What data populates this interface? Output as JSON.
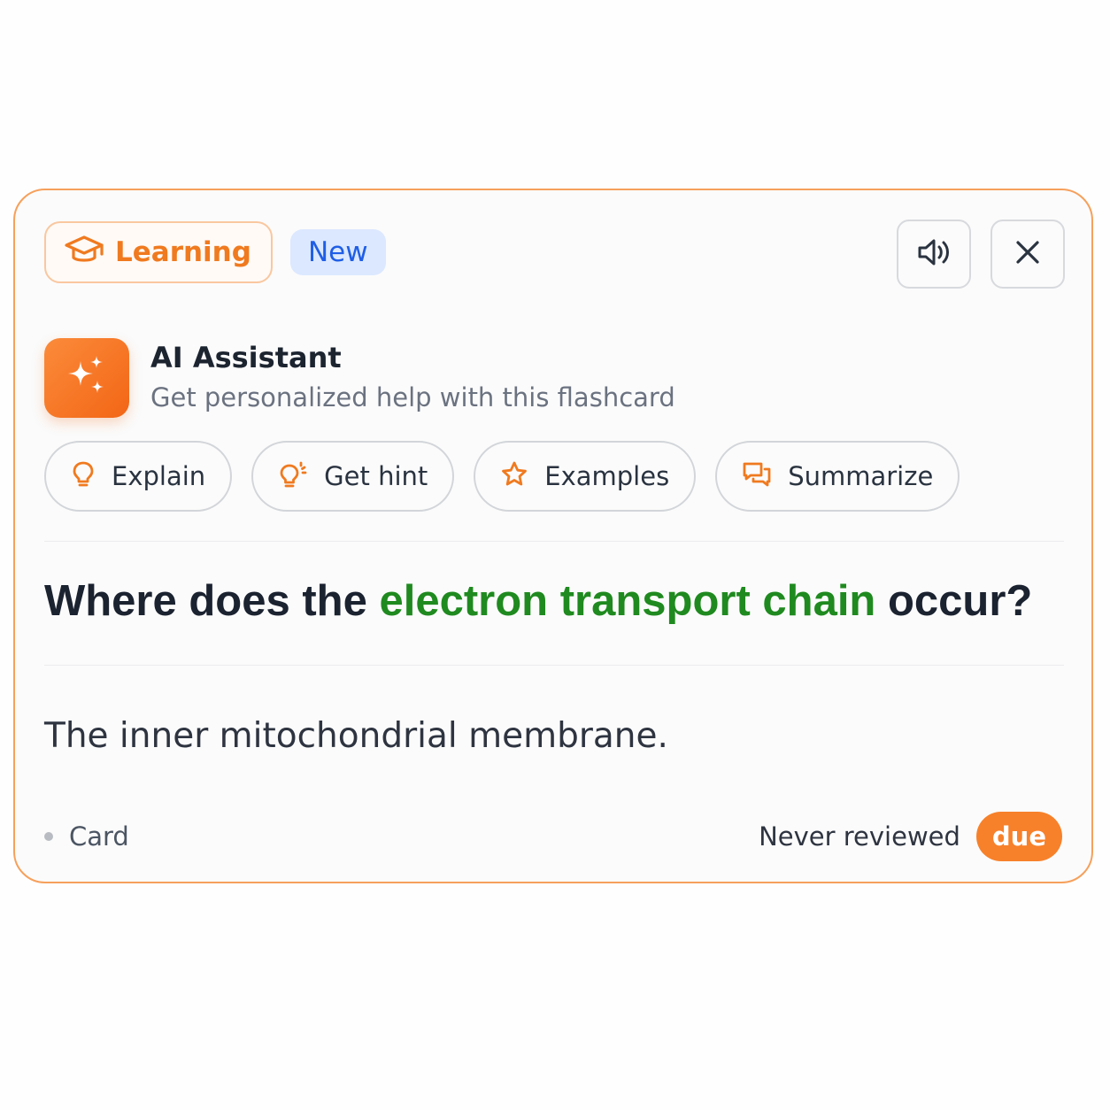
{
  "header": {
    "learning_label": "Learning",
    "new_label": "New"
  },
  "assistant": {
    "title": "AI Assistant",
    "subtitle": "Get personalized help with this flashcard"
  },
  "actions": [
    {
      "label": "Explain",
      "icon": "lightbulb-icon"
    },
    {
      "label": "Get hint",
      "icon": "hint-bulb-icon"
    },
    {
      "label": "Examples",
      "icon": "star-icon"
    },
    {
      "label": "Summarize",
      "icon": "chat-bubbles-icon"
    }
  ],
  "question": {
    "prefix": "Where does the ",
    "highlight": "electron transport chain",
    "suffix": " occur?"
  },
  "answer": "The inner mitochondrial membrane.",
  "footer": {
    "type_label": "Card",
    "review_status": "Never reviewed",
    "due_label": "due"
  },
  "colors": {
    "accent": "#f07a1f",
    "highlight": "#1f8a1f",
    "new_badge_bg": "#dbe8ff",
    "new_badge_text": "#1f5ee6"
  }
}
